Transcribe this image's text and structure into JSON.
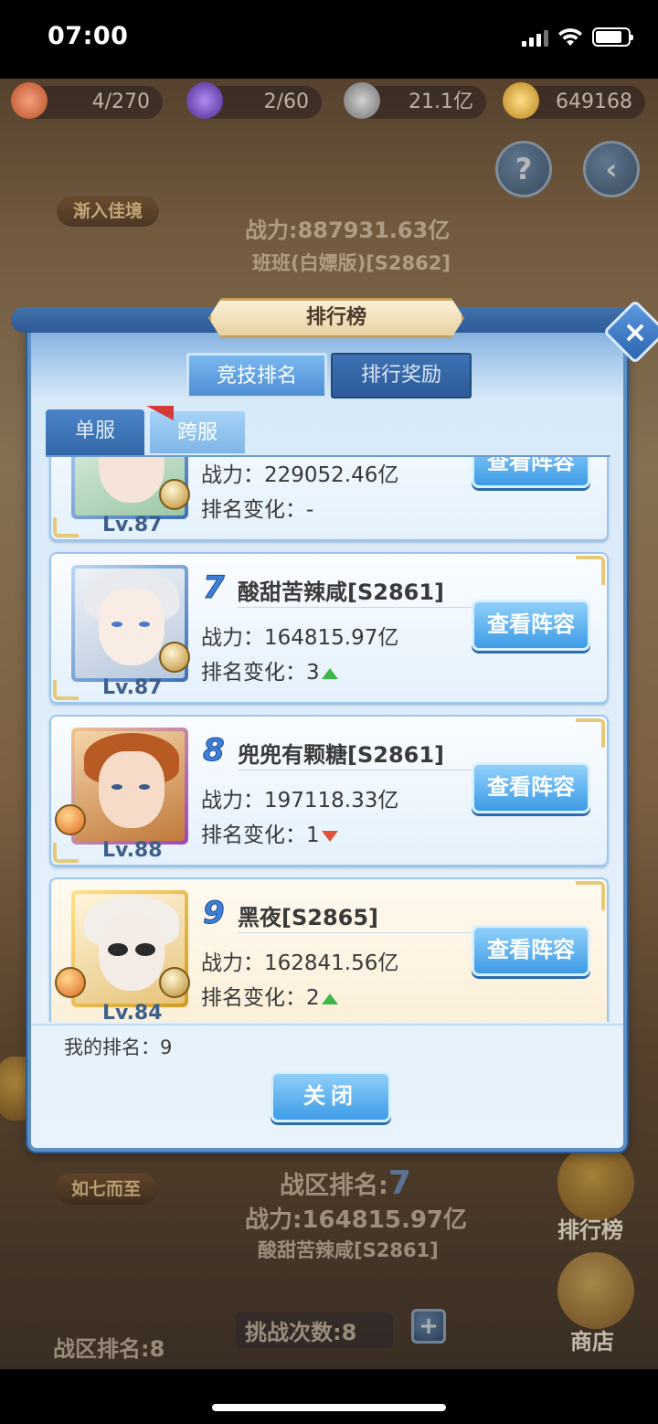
{
  "status_bar": {
    "time": "07:00"
  },
  "resources": [
    {
      "icon": "peach-icon",
      "value": "4/270"
    },
    {
      "icon": "crystal-icon",
      "value": "2/60"
    },
    {
      "icon": "coin-icon",
      "value": "21.1亿"
    },
    {
      "icon": "gold-ingot-icon",
      "value": "649168"
    }
  ],
  "background": {
    "banner_left": "渐入佳境",
    "top_power": "战力:887931.63亿",
    "top_name": "班班(白嫖版)[S2862]",
    "banner_left_bottom": "如七而至",
    "zone_rank_label": "战区排名:",
    "zone_rank_value": "7",
    "bottom_power": "战力:164815.97亿",
    "bottom_name": "酸甜苦辣咸[S2861]",
    "challenge_label": "挑战次数:",
    "challenge_value": "8",
    "zone_rank_left": "战区排名:",
    "zone_rank_left_value": "8",
    "ranking_button": "排行榜",
    "shop_button": "商店"
  },
  "modal": {
    "title": "排行榜",
    "tabs_top": [
      "竞技排名",
      "排行奖励"
    ],
    "tabs_side": [
      "单服",
      "跨服"
    ],
    "entries": [
      {
        "rank": "",
        "name": "",
        "level": "Lv.87",
        "power": "战力：229052.46亿",
        "change_label": "排名变化：",
        "change_value": "-",
        "trend": "none",
        "frame": "blue",
        "view_label": "查看阵容"
      },
      {
        "rank": "7",
        "name": "酸甜苦辣咸[S2861]",
        "level": "Lv.87",
        "power": "战力：164815.97亿",
        "change_label": "排名变化：",
        "change_value": "3",
        "trend": "up",
        "frame": "blue",
        "view_label": "查看阵容"
      },
      {
        "rank": "8",
        "name": "兜兜有颗糖[S2861]",
        "level": "Lv.88",
        "power": "战力：197118.33亿",
        "change_label": "排名变化：",
        "change_value": "1",
        "trend": "down",
        "frame": "purple",
        "view_label": "查看阵容"
      },
      {
        "rank": "9",
        "name": "黑夜[S2865]",
        "level": "Lv.84",
        "power": "战力：162841.56亿",
        "change_label": "排名变化：",
        "change_value": "2",
        "trend": "up",
        "frame": "gold",
        "view_label": "查看阵容"
      }
    ],
    "my_rank": "我的排名：9",
    "close_label": "关闭"
  }
}
